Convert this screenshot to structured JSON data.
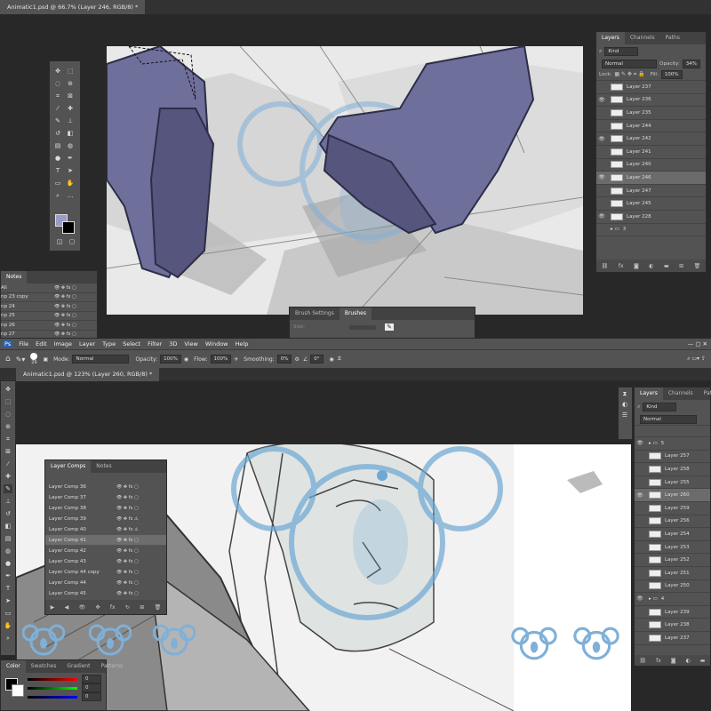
{
  "top": {
    "doc_tab": "Animatic1.psd @ 66.7% (Layer 246, RGB/8) *",
    "layers_panel": {
      "tabs": [
        "Layers",
        "Channels",
        "Paths"
      ],
      "filter": "Kind",
      "blend_mode": "Normal",
      "opacity_label": "Opacity:",
      "opacity": "34%",
      "lock_label": "Lock:",
      "fill_label": "Fill:",
      "fill": "100%",
      "layers": [
        {
          "name": "Layer 237",
          "visible": false
        },
        {
          "name": "Layer 236",
          "visible": true
        },
        {
          "name": "Layer 235",
          "visible": false
        },
        {
          "name": "Layer 244",
          "visible": false
        },
        {
          "name": "Layer 242",
          "visible": true
        },
        {
          "name": "Layer 241",
          "visible": false
        },
        {
          "name": "Layer 240",
          "visible": false
        },
        {
          "name": "Layer 246",
          "visible": true,
          "selected": true
        },
        {
          "name": "Layer 247",
          "visible": false
        },
        {
          "name": "Layer 245",
          "visible": false
        },
        {
          "name": "Layer 228",
          "visible": true
        },
        {
          "name": "3",
          "visible": false,
          "group": true
        }
      ]
    },
    "notes_panel": {
      "title": "Notes",
      "rows": [
        "All",
        "np 23 copy",
        "np 24",
        "np 25",
        "np 26",
        "np 27"
      ]
    },
    "brushes_panel": {
      "tabs": [
        "Brush Settings",
        "Brushes"
      ],
      "size_label": "Size:"
    }
  },
  "menubar": {
    "items": [
      "File",
      "Edit",
      "Image",
      "Layer",
      "Type",
      "Select",
      "Filter",
      "3D",
      "View",
      "Window",
      "Help"
    ]
  },
  "options_bar": {
    "brush_size": "29",
    "mode_label": "Mode:",
    "mode": "Normal",
    "opacity_label": "Opacity:",
    "opacity": "100%",
    "flow_label": "Flow:",
    "flow": "100%",
    "smoothing_label": "Smoothing:",
    "smoothing": "0%",
    "angle": "0°"
  },
  "bottom": {
    "doc_tab": "Animatic1.psd @ 123% (Layer 260, RGB/8) *",
    "layer_comps_panel": {
      "tabs": [
        "Layer Comps",
        "Notes"
      ],
      "comps": [
        {
          "name": "Layer Comp 36",
          "warn": false
        },
        {
          "name": "Layer Comp 37",
          "warn": false
        },
        {
          "name": "Layer Comp 38",
          "warn": false
        },
        {
          "name": "Layer Comp 39",
          "warn": true
        },
        {
          "name": "Layer Comp 40",
          "warn": true
        },
        {
          "name": "Layer Comp 41",
          "warn": false,
          "selected": true
        },
        {
          "name": "Layer Comp 42",
          "warn": false
        },
        {
          "name": "Layer Comp 43",
          "warn": false
        },
        {
          "name": "Layer Comp 44 copy",
          "warn": false
        },
        {
          "name": "Layer Comp 44",
          "warn": false
        },
        {
          "name": "Layer Comp 45",
          "warn": false
        }
      ]
    },
    "layers_panel": {
      "tabs": [
        "Layers",
        "Channels",
        "Paths"
      ],
      "filter": "Kind",
      "blend_mode": "Normal",
      "layers": [
        {
          "name": "5",
          "visible": true,
          "group": true
        },
        {
          "name": "Layer 257",
          "visible": false
        },
        {
          "name": "Layer 258",
          "visible": false
        },
        {
          "name": "Layer 255",
          "visible": false
        },
        {
          "name": "Layer 260",
          "visible": true,
          "selected": true
        },
        {
          "name": "Layer 259",
          "visible": false
        },
        {
          "name": "Layer 256",
          "visible": false
        },
        {
          "name": "Layer 254",
          "visible": false
        },
        {
          "name": "Layer 253",
          "visible": false
        },
        {
          "name": "Layer 252",
          "visible": false
        },
        {
          "name": "Layer 251",
          "visible": false
        },
        {
          "name": "Layer 250",
          "visible": false
        },
        {
          "name": "4",
          "visible": true,
          "group": true
        },
        {
          "name": "Layer 239",
          "visible": false
        },
        {
          "name": "Layer 238",
          "visible": false
        },
        {
          "name": "Layer 237",
          "visible": false
        }
      ]
    },
    "color_panel": {
      "tabs": [
        "Color",
        "Swatches",
        "Gradient",
        "Patterns"
      ],
      "values": [
        "0",
        "0",
        "0"
      ]
    }
  },
  "colors": {
    "boot": "#6f6f9c",
    "watermark": "#7fb0d8",
    "accent_blue": "#6ea8d4"
  }
}
